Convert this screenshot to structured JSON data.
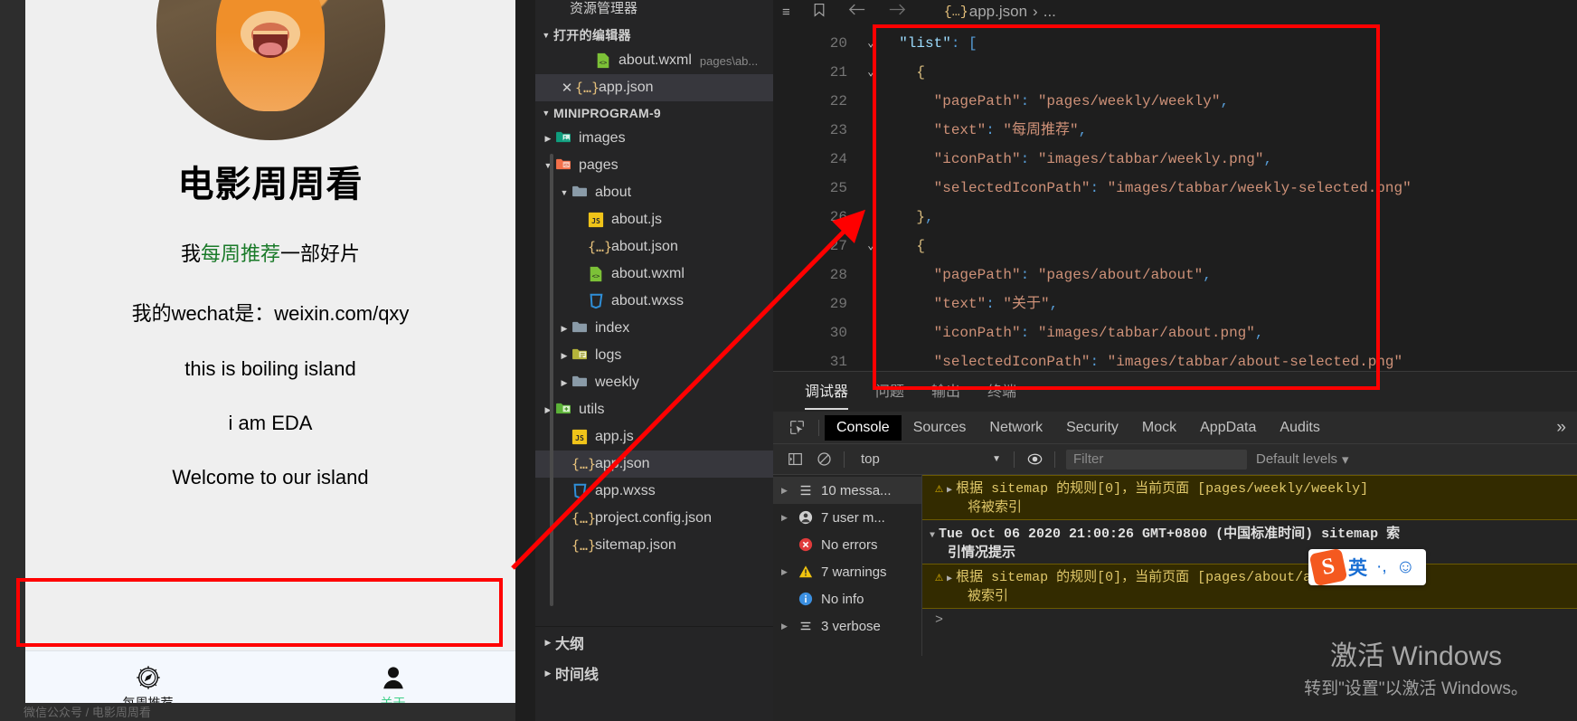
{
  "simulator": {
    "title": "电影周周看",
    "lines": [
      {
        "parts": [
          {
            "t": "我",
            "c": "black"
          },
          {
            "t": "每周推荐",
            "c": "green"
          },
          {
            "t": "一部好片",
            "c": "black"
          }
        ]
      },
      {
        "parts": [
          {
            "t": "我的wechat是：weixin.com/qxy",
            "c": "black"
          }
        ]
      },
      {
        "parts": [
          {
            "t": "this is boiling island",
            "c": "black"
          }
        ]
      },
      {
        "parts": [
          {
            "t": "i am EDA",
            "c": "black"
          }
        ]
      },
      {
        "parts": [
          {
            "t": "Welcome to our island",
            "c": "black"
          }
        ]
      }
    ],
    "avatar_alt": "lion-avatar",
    "tabbar": [
      {
        "label": "每周推荐",
        "icon": "compass-icon",
        "active": false
      },
      {
        "label": "关于",
        "icon": "person-icon",
        "active": true
      }
    ],
    "footer_strip": "微信公众号 / 电影周周看"
  },
  "explorer": {
    "title": "资源管理器",
    "open_editors": {
      "label": "打开的编辑器",
      "items": [
        {
          "name": "about.wxml",
          "meta": "pages\\ab...",
          "icon": "wxml-icon",
          "selected": false,
          "closable": false
        },
        {
          "name": "app.json",
          "meta": "",
          "icon": "json-icon",
          "selected": true,
          "closable": true
        }
      ]
    },
    "project": {
      "label": "MINIPROGRAM-9",
      "tree": [
        {
          "name": "images",
          "type": "folder",
          "icon": "folder-images-icon",
          "depth": 1,
          "expanded": false
        },
        {
          "name": "pages",
          "type": "folder",
          "icon": "folder-pages-icon",
          "depth": 1,
          "expanded": true
        },
        {
          "name": "about",
          "type": "folder",
          "icon": "folder-plain-icon",
          "depth": 2,
          "expanded": true
        },
        {
          "name": "about.js",
          "type": "file",
          "icon": "js-icon",
          "depth": 3
        },
        {
          "name": "about.json",
          "type": "file",
          "icon": "json-icon",
          "depth": 3
        },
        {
          "name": "about.wxml",
          "type": "file",
          "icon": "wxml-icon",
          "depth": 3
        },
        {
          "name": "about.wxss",
          "type": "file",
          "icon": "wxss-icon",
          "depth": 3
        },
        {
          "name": "index",
          "type": "folder",
          "icon": "folder-plain-icon",
          "depth": 2,
          "expanded": false
        },
        {
          "name": "logs",
          "type": "folder",
          "icon": "folder-logs-icon",
          "depth": 2,
          "expanded": false
        },
        {
          "name": "weekly",
          "type": "folder",
          "icon": "folder-plain-icon",
          "depth": 2,
          "expanded": false
        },
        {
          "name": "utils",
          "type": "folder",
          "icon": "folder-utils-icon",
          "depth": 1,
          "expanded": false
        },
        {
          "name": "app.js",
          "type": "file",
          "icon": "js-icon",
          "depth": 2
        },
        {
          "name": "app.json",
          "type": "file",
          "icon": "json-icon",
          "depth": 2,
          "selected": true
        },
        {
          "name": "app.wxss",
          "type": "file",
          "icon": "wxss-icon",
          "depth": 2
        },
        {
          "name": "project.config.json",
          "type": "file",
          "icon": "json-icon",
          "depth": 2
        },
        {
          "name": "sitemap.json",
          "type": "file",
          "icon": "json-icon",
          "depth": 2
        }
      ]
    },
    "bottom_sections": [
      {
        "label": "大纲"
      },
      {
        "label": "时间线"
      }
    ]
  },
  "editor": {
    "breadcrumb": {
      "file": "app.json",
      "sep": "›",
      "rest": "..."
    },
    "toolbar_icons": [
      "list-icon",
      "bookmark-icon",
      "back-arrow-icon",
      "forward-arrow-icon"
    ],
    "lines": [
      {
        "no": "20",
        "fold": "v",
        "indent": 1,
        "tokens": [
          {
            "t": "\"list\"",
            "k": "prop"
          },
          {
            "t": ": ",
            "k": "punct"
          },
          {
            "t": "[",
            "k": "punct"
          }
        ]
      },
      {
        "no": "21",
        "fold": "v",
        "indent": 2,
        "tokens": [
          {
            "t": "{",
            "k": "brace"
          }
        ]
      },
      {
        "no": "22",
        "fold": "",
        "indent": 3,
        "tokens": [
          {
            "t": "\"pagePath\"",
            "k": "key"
          },
          {
            "t": ":   ",
            "k": "punct"
          },
          {
            "t": "\"pages/weekly/weekly\"",
            "k": "str"
          },
          {
            "t": ",",
            "k": "punct"
          }
        ]
      },
      {
        "no": "23",
        "fold": "",
        "indent": 3,
        "tokens": [
          {
            "t": "\"text\"",
            "k": "key"
          },
          {
            "t": ": ",
            "k": "punct"
          },
          {
            "t": "\"每周推荐\"",
            "k": "cn"
          },
          {
            "t": ",",
            "k": "punct"
          }
        ]
      },
      {
        "no": "24",
        "fold": "",
        "indent": 3,
        "tokens": [
          {
            "t": "\"iconPath\"",
            "k": "key"
          },
          {
            "t": ": ",
            "k": "punct"
          },
          {
            "t": "\"images/tabbar/weekly.png\"",
            "k": "str"
          },
          {
            "t": ",",
            "k": "punct"
          }
        ]
      },
      {
        "no": "25",
        "fold": "",
        "indent": 3,
        "tokens": [
          {
            "t": "\"selectedIconPath\"",
            "k": "key"
          },
          {
            "t": ": ",
            "k": "punct"
          },
          {
            "t": "\"images/tabbar/weekly-selected.png\"",
            "k": "str"
          }
        ]
      },
      {
        "no": "26",
        "fold": "",
        "indent": 2,
        "tokens": [
          {
            "t": "}",
            "k": "brace"
          },
          {
            "t": ",",
            "k": "punct"
          }
        ]
      },
      {
        "no": "27",
        "fold": "v",
        "indent": 2,
        "tokens": [
          {
            "t": "{",
            "k": "brace"
          }
        ]
      },
      {
        "no": "28",
        "fold": "",
        "indent": 3,
        "tokens": [
          {
            "t": "\"pagePath\"",
            "k": "key"
          },
          {
            "t": ":   ",
            "k": "punct"
          },
          {
            "t": "\"pages/about/about\"",
            "k": "str"
          },
          {
            "t": ",",
            "k": "punct"
          }
        ]
      },
      {
        "no": "29",
        "fold": "",
        "indent": 3,
        "tokens": [
          {
            "t": "\"text\"",
            "k": "key"
          },
          {
            "t": ": ",
            "k": "punct"
          },
          {
            "t": "\"关于\"",
            "k": "cn"
          },
          {
            "t": ",",
            "k": "punct"
          }
        ]
      },
      {
        "no": "30",
        "fold": "",
        "indent": 3,
        "tokens": [
          {
            "t": "\"iconPath\"",
            "k": "key"
          },
          {
            "t": ": ",
            "k": "punct"
          },
          {
            "t": "\"images/tabbar/about.png\"",
            "k": "str"
          },
          {
            "t": ",",
            "k": "punct"
          }
        ]
      },
      {
        "no": "31",
        "fold": "",
        "indent": 3,
        "tokens": [
          {
            "t": "\"selectedIconPath\"",
            "k": "key"
          },
          {
            "t": ": ",
            "k": "punct"
          },
          {
            "t": "\"images/tabbar/about-selected.png\"",
            "k": "str"
          }
        ]
      }
    ]
  },
  "devtools": {
    "panel_tabs": [
      {
        "label": "调试器",
        "active": true
      },
      {
        "label": "问题",
        "active": false
      },
      {
        "label": "输出",
        "active": false
      },
      {
        "label": "终端",
        "active": false
      }
    ],
    "dt_tabs": [
      {
        "label": "Console",
        "active": true
      },
      {
        "label": "Sources",
        "active": false
      },
      {
        "label": "Network",
        "active": false
      },
      {
        "label": "Security",
        "active": false
      },
      {
        "label": "Mock",
        "active": false
      },
      {
        "label": "AppData",
        "active": false
      },
      {
        "label": "Audits",
        "active": false
      }
    ],
    "dt_more": "»",
    "console_toolbar": {
      "context": "top",
      "filter_placeholder": "Filter",
      "levels": "Default levels",
      "levels_caret": "▾"
    },
    "message_sidebar": [
      {
        "label": "10 messa...",
        "icon": "list-icon",
        "caret": true,
        "selected": true
      },
      {
        "label": "7 user m...",
        "icon": "user-icon",
        "caret": true,
        "selected": false
      },
      {
        "label": "No errors",
        "icon": "error-icon",
        "caret": false,
        "selected": false
      },
      {
        "label": "7 warnings",
        "icon": "warning-icon",
        "caret": true,
        "selected": false
      },
      {
        "label": "No info",
        "icon": "info-icon",
        "caret": false,
        "selected": false
      },
      {
        "label": "3 verbose",
        "icon": "verbose-icon",
        "caret": true,
        "selected": false
      }
    ],
    "log_entries": [
      {
        "type": "warning",
        "line1": "根据 sitemap 的规则[0]，当前页面 [pages/weekly/weekly]",
        "line2": "将被索引"
      },
      {
        "type": "group",
        "line1": "Tue Oct 06 2020 21:00:26 GMT+0800 (中国标准时间) sitemap 索",
        "line2": "引情况提示"
      },
      {
        "type": "warning",
        "line1": "根据 sitemap 的规则[0]，当前页面 [pages/about/about]",
        "line2": "被索引"
      },
      {
        "type": "prompt",
        "line1": "",
        "line2": ""
      }
    ]
  },
  "windows_activation": {
    "title": "激活 Windows",
    "subtitle": "转到\"设置\"以激活 Windows。"
  },
  "ime": {
    "mode": "英",
    "punct": "·,",
    "emoji": "☺"
  },
  "colors": {
    "accent_red": "#ff0000",
    "tab_active_green": "#3fd08a",
    "editor_bg": "#1e1e1e",
    "explorer_bg": "#252526",
    "warn_bg": "#332b00"
  }
}
